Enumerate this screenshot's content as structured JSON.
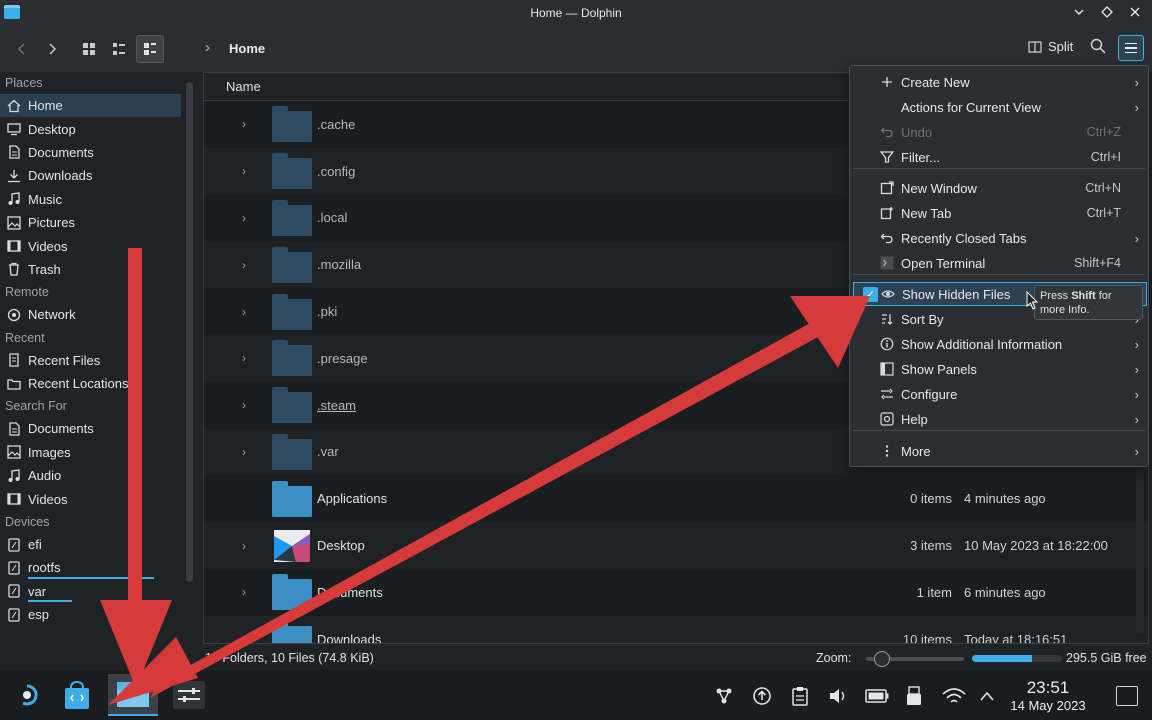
{
  "window": {
    "title": "Home — Dolphin"
  },
  "toolbar": {
    "breadcrumb": "Home",
    "split_label": "Split"
  },
  "sidebar": {
    "sections": [
      {
        "title": "Places",
        "items": [
          {
            "label": "Home",
            "icon": "home-icon",
            "selected": true
          },
          {
            "label": "Desktop",
            "icon": "desktop-icon"
          },
          {
            "label": "Documents",
            "icon": "documents-icon"
          },
          {
            "label": "Downloads",
            "icon": "downloads-icon"
          },
          {
            "label": "Music",
            "icon": "music-icon"
          },
          {
            "label": "Pictures",
            "icon": "pictures-icon"
          },
          {
            "label": "Videos",
            "icon": "videos-icon"
          },
          {
            "label": "Trash",
            "icon": "trash-icon"
          }
        ]
      },
      {
        "title": "Remote",
        "items": [
          {
            "label": "Network",
            "icon": "network-icon"
          }
        ]
      },
      {
        "title": "Recent",
        "items": [
          {
            "label": "Recent Files",
            "icon": "recent-files-icon"
          },
          {
            "label": "Recent Locations",
            "icon": "recent-locations-icon"
          }
        ]
      },
      {
        "title": "Search For",
        "items": [
          {
            "label": "Documents",
            "icon": "documents-icon"
          },
          {
            "label": "Images",
            "icon": "images-icon"
          },
          {
            "label": "Audio",
            "icon": "audio-icon"
          },
          {
            "label": "Videos",
            "icon": "videos-icon"
          }
        ]
      },
      {
        "title": "Devices",
        "items": [
          {
            "label": "efi",
            "icon": "drive-icon"
          },
          {
            "label": "rootfs",
            "icon": "drive-icon",
            "usage": 0.85
          },
          {
            "label": "var",
            "icon": "drive-icon",
            "usage": 0.3
          },
          {
            "label": "esp",
            "icon": "drive-icon"
          }
        ]
      }
    ]
  },
  "filelist": {
    "column_name": "Name",
    "rows": [
      {
        "name": ".cache",
        "hidden": true,
        "expandable": true,
        "count": "",
        "date": ""
      },
      {
        "name": ".config",
        "hidden": true,
        "expandable": true,
        "count": "",
        "date": ""
      },
      {
        "name": ".local",
        "hidden": true,
        "expandable": true,
        "count": "",
        "date": ""
      },
      {
        "name": ".mozilla",
        "hidden": true,
        "expandable": true,
        "count": "",
        "date": ""
      },
      {
        "name": ".pki",
        "hidden": true,
        "expandable": true,
        "count": "",
        "date": ""
      },
      {
        "name": ".presage",
        "hidden": true,
        "expandable": true,
        "count": "",
        "date": ""
      },
      {
        "name": ".steam",
        "hidden": true,
        "expandable": true,
        "count": "",
        "date": ""
      },
      {
        "name": ".var",
        "hidden": true,
        "expandable": true,
        "count": "",
        "date": ""
      },
      {
        "name": "Applications",
        "hidden": false,
        "expandable": false,
        "count": "0 items",
        "date": "4 minutes ago"
      },
      {
        "name": "Desktop",
        "hidden": false,
        "expandable": true,
        "count": "3 items",
        "date": "10 May 2023 at 18:22:00"
      },
      {
        "name": "Documents",
        "hidden": false,
        "expandable": true,
        "count": "1 item",
        "date": "6 minutes ago"
      },
      {
        "name": "Downloads",
        "hidden": false,
        "expandable": true,
        "count": "10 items",
        "date": "Today at 18:16:51"
      }
    ]
  },
  "statusbar": {
    "info": "19 Folders, 10 Files (74.8 KiB)",
    "zoom_label": "Zoom:",
    "free_space": "295.5 GiB free",
    "space_used_fraction": 0.67
  },
  "menu": {
    "items": [
      {
        "label": "Create New",
        "icon": "plus-icon",
        "shortcut": "",
        "submenu": true
      },
      {
        "label": "Actions for Current View",
        "icon": "",
        "shortcut": "",
        "submenu": true
      },
      {
        "label": "Undo",
        "icon": "undo-icon",
        "shortcut": "Ctrl+Z",
        "disabled": true
      },
      {
        "label": "Filter...",
        "icon": "filter-icon",
        "shortcut": "Ctrl+I"
      },
      {
        "label": "New Window",
        "icon": "new-window-icon",
        "shortcut": "Ctrl+N"
      },
      {
        "label": "New Tab",
        "icon": "new-tab-icon",
        "shortcut": "Ctrl+T"
      },
      {
        "label": "Recently Closed Tabs",
        "icon": "undo-icon",
        "shortcut": "",
        "submenu": true
      },
      {
        "label": "Open Terminal",
        "icon": "terminal-icon",
        "shortcut": "Shift+F4"
      },
      {
        "label": "Show Hidden Files",
        "icon": "eye-icon",
        "shortcut": "",
        "checked": true
      },
      {
        "label": "Sort By",
        "icon": "sort-icon",
        "shortcut": "",
        "submenu": true
      },
      {
        "label": "Show Additional Information",
        "icon": "info-icon",
        "shortcut": "",
        "submenu": true
      },
      {
        "label": "Show Panels",
        "icon": "panels-icon",
        "shortcut": "",
        "submenu": true
      },
      {
        "label": "Configure",
        "icon": "configure-icon",
        "shortcut": "",
        "submenu": true
      },
      {
        "label": "Help",
        "icon": "help-icon",
        "shortcut": "",
        "submenu": true
      },
      {
        "label": "More",
        "icon": "more-icon",
        "shortcut": "",
        "submenu": true
      }
    ]
  },
  "tooltip": {
    "pre": "Press ",
    "bold": "Shift",
    "post": " for more Info."
  },
  "taskbar": {
    "time": "23:51",
    "date": "14 May 2023"
  },
  "colors": {
    "accent": "#3daee9",
    "arrow": "#d63a3a"
  }
}
